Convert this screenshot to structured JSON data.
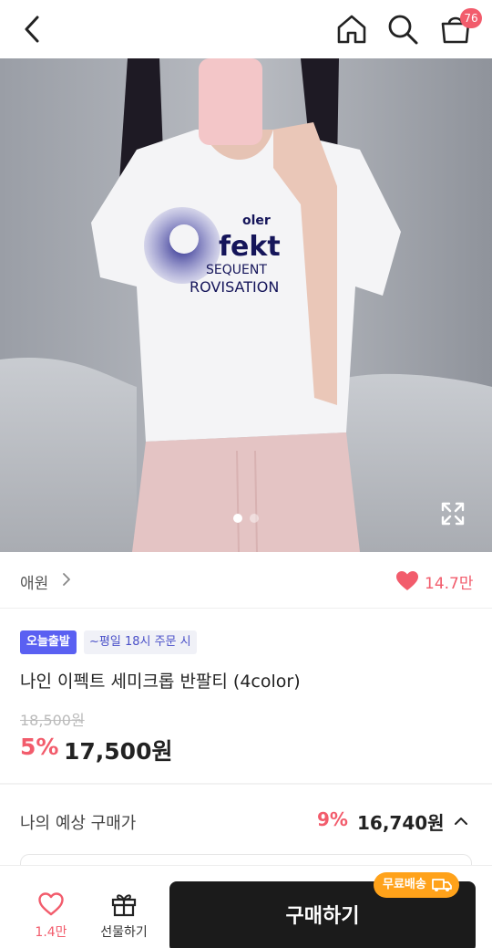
{
  "header": {
    "cart_count": "76",
    "icons": [
      "back-icon",
      "home-icon",
      "search-icon",
      "cart-icon"
    ]
  },
  "gallery": {
    "total": 2,
    "current": 1,
    "expand_icon": "expand-icon",
    "shirt_text": [
      "oler",
      "fekt",
      "SEQUENT",
      "ROVISATION"
    ]
  },
  "brand": {
    "name": "애원",
    "likes": "14.7만"
  },
  "product": {
    "badge_today": "오늘출발",
    "badge_time": "~평일 18시 주문 시",
    "title": "나인 이펙트 세미크롭 반팔티 (4color)",
    "original_price": "18,500원",
    "discount": "5%",
    "price": "17,500원"
  },
  "expected": {
    "label": "나의 예상 구매가",
    "rate": "9%",
    "price": "16,740원"
  },
  "bottom": {
    "wish_count": "1.4만",
    "gift_label": "선물하기",
    "buy_label": "구매하기",
    "free_shipping": "무료배송"
  },
  "colors": {
    "accent_red": "#f25c6c",
    "badge_blue": "#5a60f2",
    "ship_orange": "#ffa21a",
    "buy_button": "#1b1b1b"
  }
}
